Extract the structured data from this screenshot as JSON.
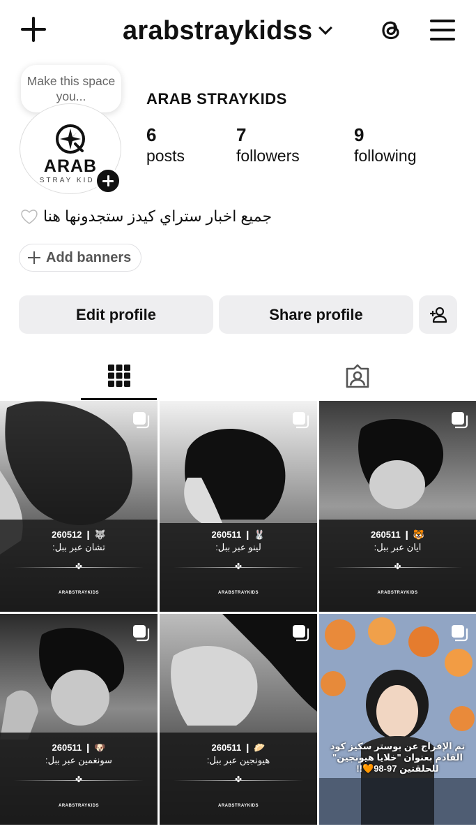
{
  "header": {
    "username": "arabstraykidss",
    "icons": [
      "create-plus-icon",
      "chevron-down-icon",
      "threads-icon",
      "menu-icon"
    ]
  },
  "profile": {
    "note": "Make this space you...",
    "avatar_logo_text": "ARAB",
    "avatar_logo_sub": "STRAY KIDS",
    "display_name": "ARAB STRAYKIDS",
    "stats": [
      {
        "value": "6",
        "label": "posts"
      },
      {
        "value": "7",
        "label": "followers"
      },
      {
        "value": "9",
        "label": "following"
      }
    ],
    "bio": "جميع اخبار ستراي كيدز ستجدونها هنا",
    "add_banners": "Add banners"
  },
  "actions": {
    "edit_profile": "Edit profile",
    "share_profile": "Share profile"
  },
  "tabs": [
    "grid-icon",
    "tagged-icon"
  ],
  "posts": [
    {
      "date": "260512 ❙ 🐺",
      "name": "تشان عبر ببل:",
      "brand": "ARABSTRAYKIDS"
    },
    {
      "date": "260511 ❙ 🐰",
      "name": "لينو عبر ببل:",
      "brand": "ARABSTRAYKIDS"
    },
    {
      "date": "260511 ❙ 🐯",
      "name": "ايان عبر ببل:",
      "brand": "ARABSTRAYKIDS"
    },
    {
      "date": "260511 ❙ 🐶",
      "name": "سونغمين عبر ببل:",
      "brand": "ARABSTRAYKIDS"
    },
    {
      "date": "260511 ❙ 🥟",
      "name": "هيونجين عبر ببل:",
      "brand": "ARABSTRAYKIDS"
    },
    {
      "caption": "تم الإفراج عن بوستر سكيز كود القادم بعنوان \"خلايا هيونجين\" للحلقتين 97-98🧡!!"
    }
  ],
  "colors": {
    "button_bg": "#eeeef0",
    "text": "#111111",
    "border": "#e0e0e3"
  }
}
